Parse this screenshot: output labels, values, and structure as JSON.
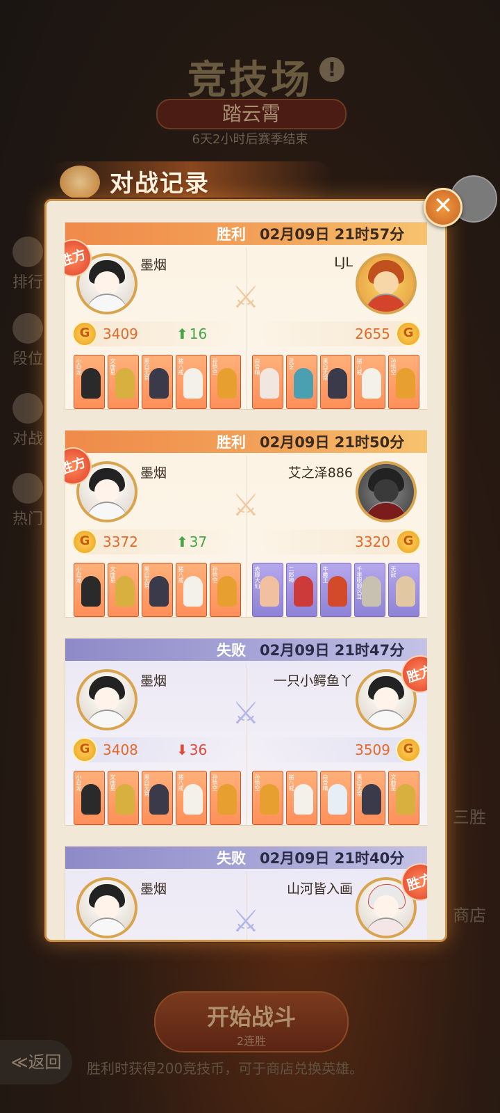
{
  "background": {
    "title": "竞技场",
    "info_icon": "exclamation-icon",
    "season_name": "踏云霄",
    "season_end": "6天2小时后赛季结束",
    "side_menu": [
      "排行",
      "段位",
      "对战",
      "热门"
    ],
    "right_labels": [
      "三胜",
      "商店"
    ],
    "start_button": "开始战斗",
    "start_sub": "2连胜",
    "back_button": "≪返回",
    "tip": "胜利时获得200竞技币，可于商店兑换英雄。"
  },
  "dialog": {
    "title": "对战记录",
    "close_icon": "close-icon"
  },
  "records": [
    {
      "result": "胜利",
      "outcome": "win",
      "time": "02月09日  21时57分",
      "left": {
        "name": "墨烟",
        "score": "3409",
        "delta": "16",
        "dir": "up",
        "winner": true,
        "avatar": "lady"
      },
      "right": {
        "name": "LJL",
        "score": "2655",
        "winner": false,
        "avatar": "monkey"
      },
      "left_team": [
        {
          "name": "小白龙",
          "color": "#2a2a2a"
        },
        {
          "name": "文曲星",
          "color": "#d8b040"
        },
        {
          "name": "黑白无常",
          "color": "#3a3a4a"
        },
        {
          "name": "猪八戒",
          "color": "#f4f0ea"
        },
        {
          "name": "孙悟空",
          "color": "#e7a030"
        }
      ],
      "right_team": [
        {
          "name": "白骨精",
          "color": "#f2e6e0"
        },
        {
          "name": "灵芝",
          "color": "#4aa0b0"
        },
        {
          "name": "黑白无常",
          "color": "#3a3a4a"
        },
        {
          "name": "猪八戒",
          "color": "#f4f0ea"
        },
        {
          "name": "孙悟空",
          "color": "#e7a030"
        }
      ],
      "left_purple": false,
      "right_purple": false
    },
    {
      "result": "胜利",
      "outcome": "win",
      "time": "02月09日  21时50分",
      "left": {
        "name": "墨烟",
        "score": "3372",
        "delta": "37",
        "dir": "up",
        "winner": true,
        "avatar": "lady"
      },
      "right": {
        "name": "艾之泽886",
        "score": "3320",
        "winner": false,
        "avatar": "bear"
      },
      "left_team": [
        {
          "name": "小白龙",
          "color": "#2a2a2a"
        },
        {
          "name": "文曲星",
          "color": "#d8b040"
        },
        {
          "name": "黑白无常",
          "color": "#3a3a4a"
        },
        {
          "name": "猪八戒",
          "color": "#f4f0ea"
        },
        {
          "name": "孙悟空",
          "color": "#e7a030"
        }
      ],
      "right_team": [
        {
          "name": "赤脚大仙",
          "color": "#f0c0a0"
        },
        {
          "name": "二郎神",
          "color": "#cc3a3a"
        },
        {
          "name": "牛魔王",
          "color": "#d24a2a"
        },
        {
          "name": "千里眼顺风耳",
          "color": "#c8c0b0"
        },
        {
          "name": "无敌",
          "color": "#e2c8a2"
        }
      ],
      "left_purple": false,
      "right_purple": true
    },
    {
      "result": "失败",
      "outcome": "lose",
      "time": "02月09日  21时47分",
      "left": {
        "name": "墨烟",
        "score": "3408",
        "delta": "36",
        "dir": "down",
        "winner": false,
        "avatar": "lady"
      },
      "right": {
        "name": "一只小鳄鱼丫",
        "score": "3509",
        "winner": true,
        "avatar": "lady"
      },
      "left_team": [
        {
          "name": "小白龙",
          "color": "#2a2a2a"
        },
        {
          "name": "文曲星",
          "color": "#d8b040"
        },
        {
          "name": "黑白无常",
          "color": "#3a3a4a"
        },
        {
          "name": "猪八戒",
          "color": "#f4f0ea"
        },
        {
          "name": "孙悟空",
          "color": "#e7a030"
        }
      ],
      "right_team": [
        {
          "name": "孙悟空",
          "color": "#e7a030"
        },
        {
          "name": "猪八戒",
          "color": "#f4f0ea"
        },
        {
          "name": "白骨精",
          "color": "#e8eef6"
        },
        {
          "name": "黑白无常",
          "color": "#3a3a4a"
        },
        {
          "name": "文曲星",
          "color": "#d8b040"
        }
      ],
      "left_purple": false,
      "right_purple": false
    },
    {
      "result": "失败",
      "outcome": "lose",
      "time": "02月09日  21时40分",
      "left": {
        "name": "墨烟",
        "score": "",
        "delta": "",
        "dir": "",
        "winner": false,
        "avatar": "lady"
      },
      "right": {
        "name": "山河皆入画",
        "score": "",
        "winner": true,
        "avatar": "fox"
      },
      "left_team": [],
      "right_team": [],
      "left_purple": false,
      "right_purple": false
    }
  ],
  "labels": {
    "win_badge": "胜方",
    "vs_icon": "crossed-swords-icon",
    "coin_letter": "G"
  }
}
